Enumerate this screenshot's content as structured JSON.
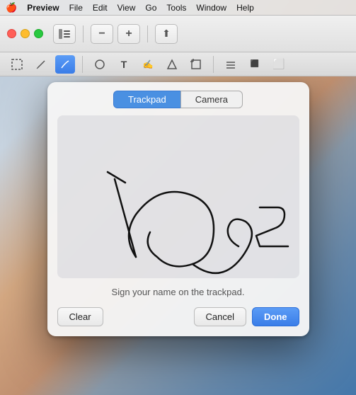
{
  "menubar": {
    "apple": "🍎",
    "app_name": "Preview",
    "items": [
      "File",
      "Edit",
      "View",
      "Go",
      "Tools",
      "Window",
      "Help"
    ]
  },
  "toolbar": {
    "traffic_lights": [
      "close",
      "minimize",
      "maximize"
    ]
  },
  "toolbar2": {
    "tools": [
      "⬜",
      "✏️",
      "✒️",
      "T",
      "✍️",
      "▲",
      "⬚",
      "☰",
      "⬛",
      "⬜"
    ]
  },
  "dialog": {
    "tabs": [
      {
        "label": "Trackpad",
        "active": true
      },
      {
        "label": "Camera",
        "active": false
      }
    ],
    "instruction": "Sign your name on the trackpad.",
    "buttons": {
      "clear": "Clear",
      "cancel": "Cancel",
      "done": "Done"
    }
  },
  "colors": {
    "active_tab_bg": "#4a90e2",
    "done_btn_bg": "#3a7de8"
  }
}
